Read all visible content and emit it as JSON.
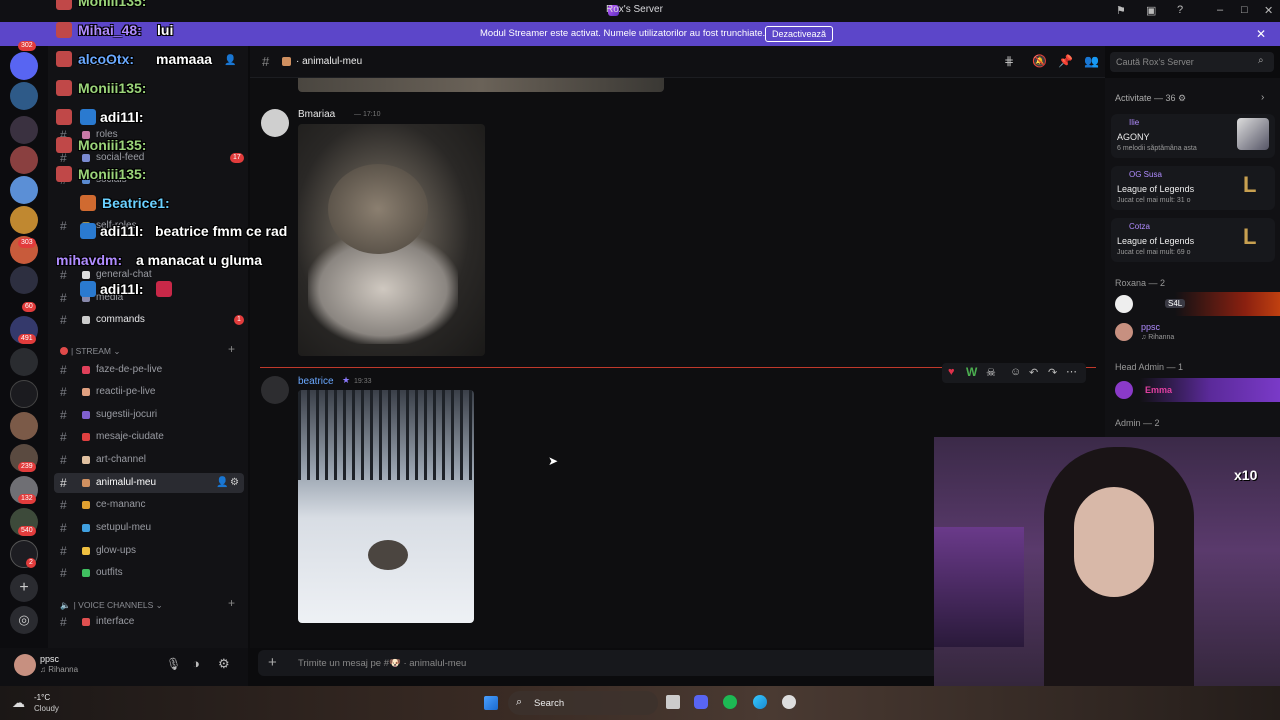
{
  "window": {
    "title": "Rox's Server"
  },
  "banner": {
    "text": "Modul Streamer este activat. Numele utilizatorilor au fost trunchiate.",
    "button": "Dezactivează"
  },
  "server_badges": [
    "302",
    "303",
    "60",
    "491",
    "239",
    "132",
    "540",
    "2"
  ],
  "sidebar": {
    "server_name": "Rox's Server",
    "channels_top": [
      {
        "name": "roles"
      },
      {
        "name": "social-feed",
        "badge": "17"
      },
      {
        "name": "socials"
      },
      {
        "name": "self-roles"
      },
      {
        "name": "general-chat"
      },
      {
        "name": "media"
      },
      {
        "name": "commands",
        "badge": "1"
      }
    ],
    "category_stream": "| STREAM",
    "stream_channels": [
      "faze-de-pe-live",
      "reactii-pe-live",
      "sugestii-jocuri",
      "mesaje-ciudate",
      "art-channel",
      "animalul-meu",
      "ce-mananc",
      "setupul-meu",
      "glow-ups",
      "outfits"
    ],
    "category_voice": "| VOICE CHANNELS",
    "voice_channels": [
      "interface"
    ]
  },
  "user": {
    "name": "ppsc",
    "status": "Rihanna"
  },
  "weather": {
    "temp": "-1°C",
    "desc": "Cloudy"
  },
  "chat": {
    "channel": "animalul-meu",
    "search_placeholder": "Caută Rox's Server",
    "messages": [
      {
        "author": "Bmariaa",
        "time": "17:10"
      },
      {
        "author": "beatrice",
        "time": "19:33"
      }
    ],
    "input_placeholder": "Trimite un mesaj pe #🐶 · animalul-meu"
  },
  "members": {
    "activity_header": "Activitate — 36",
    "activities": [
      {
        "user": "Ilie",
        "game": "AGONY",
        "detail": "6 melodii săptămâna asta"
      },
      {
        "user": "OG Susa",
        "game": "League of Legends",
        "detail": "Jucat cel mai mult: 31 o"
      },
      {
        "user": "Cotza",
        "game": "League of Legends",
        "detail": "Jucat cel mai mult: 69 o"
      }
    ],
    "groups": [
      {
        "name": "Roxana — 2",
        "members": [
          {
            "name": "S4L"
          },
          {
            "name": "ppsc",
            "status": "Rihanna"
          }
        ]
      },
      {
        "name": "Head Admin — 1",
        "members": [
          {
            "name": "Emma"
          }
        ]
      },
      {
        "name": "Admin — 2",
        "members": []
      }
    ]
  },
  "taskbar": {
    "search": "Search"
  },
  "overlay_chat": [
    {
      "user": "Moniii135:",
      "text": "",
      "color": "#9bd47a"
    },
    {
      "user": "Mihai_48:",
      "text": "lui",
      "color": "#b08cff"
    },
    {
      "user": "alcoOtx:",
      "text": "mamaaa",
      "color": "#6aa9ff"
    },
    {
      "user": "Moniii135:",
      "text": "",
      "color": "#9bd47a"
    },
    {
      "user": "adi11l:",
      "text": "",
      "color": "#ffffff"
    },
    {
      "user": "Moniii135:",
      "text": "",
      "color": "#9bd47a"
    },
    {
      "user": "Moniii135:",
      "text": "",
      "color": "#9bd47a"
    },
    {
      "user": "Beatrice1:",
      "text": "",
      "color": "#6ad0ff"
    },
    {
      "user": "adi11l:",
      "text": "beatrice fmm ce rad",
      "color": "#ffffff"
    },
    {
      "user": "mihavdm:",
      "text": "a manacat u gluma",
      "color": "#b08cff"
    },
    {
      "user": "adi11l:",
      "text": "",
      "color": "#ffffff"
    }
  ]
}
